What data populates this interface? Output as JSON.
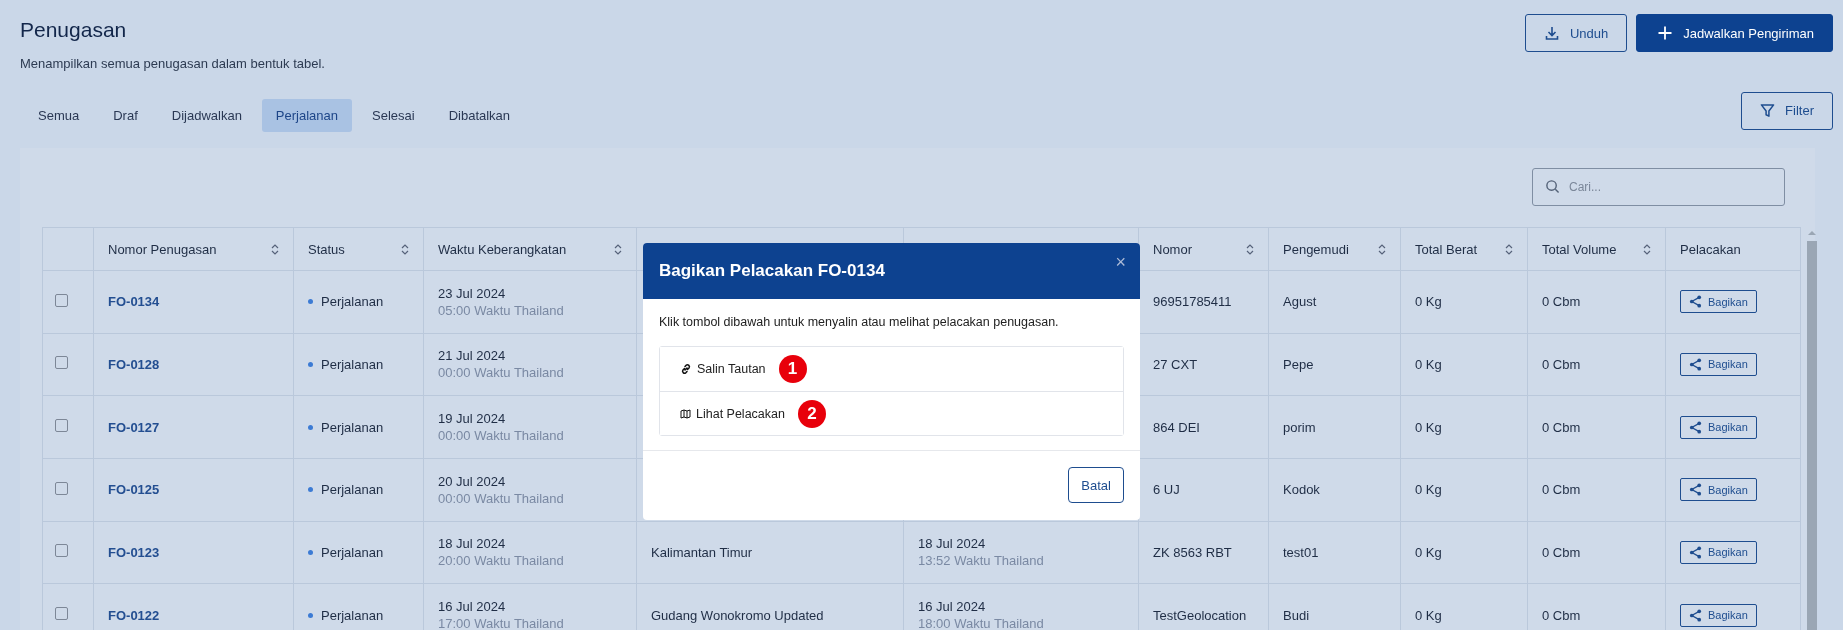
{
  "page": {
    "title": "Penugasan",
    "subtitle": "Menampilkan semua penugasan dalam bentuk tabel."
  },
  "actions": [
    {
      "kind": "download",
      "label": "Unduh"
    },
    {
      "kind": "add",
      "label": "Jadwalkan Pengiriman"
    }
  ],
  "tabs": [
    {
      "label": "Semua",
      "selected": false
    },
    {
      "label": "Draf",
      "selected": false
    },
    {
      "label": "Dijadwalkan",
      "selected": false
    },
    {
      "label": "Perjalanan",
      "selected": true
    },
    {
      "label": "Selesai",
      "selected": false
    },
    {
      "label": "Dibatalkan",
      "selected": false
    }
  ],
  "filter_button": "Filter",
  "search": {
    "placeholder": "Cari..."
  },
  "table": {
    "columns": [
      {
        "sortable": false
      },
      {
        "label": "Nomor Penugasan",
        "sortable": true
      },
      {
        "label": "Status",
        "sortable": true
      },
      {
        "label": "Waktu Keberangkatan",
        "sortable": true
      },
      {},
      {},
      {
        "label": "Nomor",
        "sortable": true
      },
      {
        "label": "Pengemudi",
        "sortable": true
      },
      {
        "label": "Total Berat",
        "sortable": true
      },
      {
        "label": "Total Volume",
        "sortable": true
      },
      {
        "label": "Pelacakan",
        "sortable": false
      }
    ],
    "rows": [
      {
        "checked": false,
        "number": "FO-0134",
        "status": "Perjalanan",
        "departure_date": "23 Jul 2024",
        "departure_time": "05:00 Waktu Thailand",
        "column_7": "96951785411",
        "driver": "Agust",
        "weight": "0 Kg",
        "volume": "0 Cbm",
        "action": "Bagikan"
      },
      {
        "checked": false,
        "number": "FO-0128",
        "status": "Perjalanan",
        "departure_date": "21 Jul 2024",
        "departure_time": "00:00 Waktu Thailand",
        "column_7": "27 CXT",
        "driver": "Pepe",
        "weight": "0 Kg",
        "volume": "0 Cbm",
        "action": "Bagikan"
      },
      {
        "checked": false,
        "number": "FO-0127",
        "status": "Perjalanan",
        "departure_date": "19 Jul 2024",
        "departure_time": "00:00 Waktu Thailand",
        "column_7": "864 DEI",
        "driver": "porim",
        "weight": "0 Kg",
        "volume": "0 Cbm",
        "action": "Bagikan"
      },
      {
        "checked": false,
        "number": "FO-0125",
        "status": "Perjalanan",
        "departure_date": "20 Jul 2024",
        "departure_time": "00:00 Waktu Thailand",
        "column_7": "6 UJ",
        "driver": "Kodok",
        "weight": "0 Kg",
        "volume": "0 Cbm",
        "action": "Bagikan"
      },
      {
        "checked": false,
        "number": "FO-0123",
        "status": "Perjalanan",
        "departure_date": "18 Jul 2024",
        "departure_time": "20:00 Waktu Thailand",
        "column_5": "Kalimantan Timur",
        "column_6_date": "18 Jul 2024",
        "column_6_time": "13:52 Waktu Thailand",
        "column_7": "ZK 8563 RBT",
        "driver": "test01",
        "weight": "0 Kg",
        "volume": "0 Cbm",
        "action": "Bagikan"
      },
      {
        "checked": false,
        "number": "FO-0122",
        "status": "Perjalanan",
        "departure_date": "16 Jul 2024",
        "departure_time": "17:00 Waktu Thailand",
        "column_5": "Gudang Wonokromo Updated",
        "column_6_date": "16 Jul 2024",
        "column_6_time": "18:00 Waktu Thailand",
        "column_7": "TestGeolocation",
        "driver": "Budi",
        "weight": "0 Kg",
        "volume": "0 Cbm",
        "action": "Bagikan"
      }
    ]
  },
  "modal": {
    "title": "Bagikan Pelacakan FO-0134",
    "close": "×",
    "text": "Klik tombol dibawah untuk menyalin atau melihat pelacakan penugasan.",
    "options": [
      {
        "kind": "link",
        "label": "Salin Tautan",
        "badge": "1"
      },
      {
        "kind": "map",
        "label": "Lihat Pelacakan",
        "badge": "2"
      }
    ],
    "cancel": "Batal"
  }
}
